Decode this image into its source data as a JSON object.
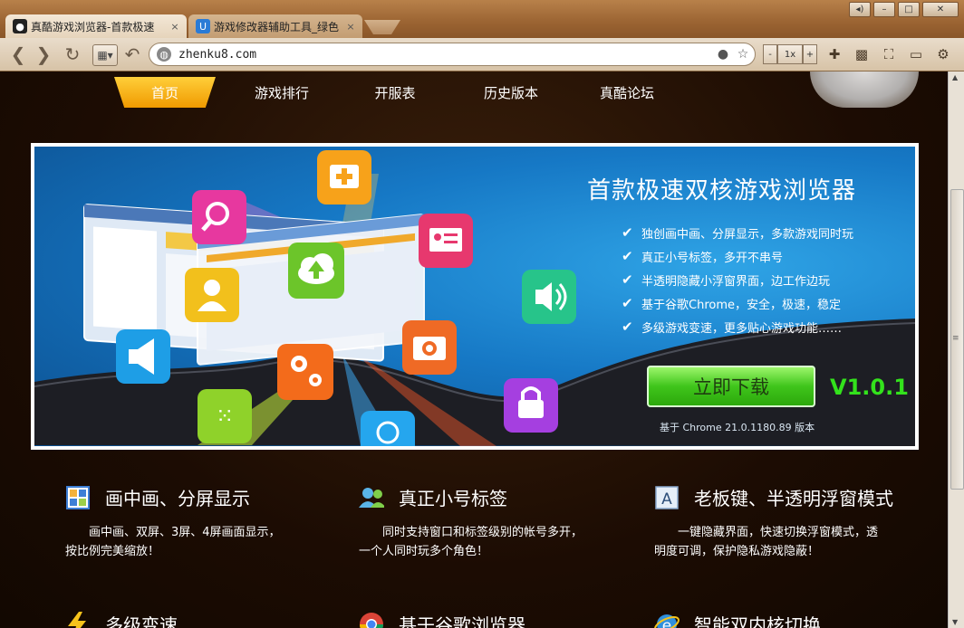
{
  "browser": {
    "tabs": [
      {
        "title": "真酷游戏浏览器-首款极速",
        "close": "×",
        "active": true
      },
      {
        "title": "游戏修改器辅助工具_绿色",
        "close": "×",
        "active": false
      }
    ],
    "window_controls": {
      "minimize": "–",
      "maximize": "□",
      "close": "✕"
    },
    "address": "zhenku8.com",
    "zoom": {
      "minus": "-",
      "level": "1x",
      "plus": "+"
    },
    "accent": "#9a6332"
  },
  "site": {
    "nav": [
      "首页",
      "游戏排行",
      "开服表",
      "历史版本",
      "真酷论坛"
    ],
    "banner": {
      "title": "首款极速双核游戏浏览器",
      "features": [
        "独创画中画、分屏显示，多款游戏同时玩",
        "真正小号标签，多开不串号",
        "半透明隐藏小浮窗界面，边工作边玩",
        "基于谷歌Chrome，安全，极速，稳定",
        "多级游戏变速，更多贴心游戏功能……"
      ],
      "download": "立即下载",
      "version": "V1.0.1",
      "based_on": "基于 Chrome 21.0.1180.89 版本",
      "download_color": "#3fc51b",
      "version_color": "#33e21c"
    },
    "features": [
      {
        "icon": "picture-in-picture-icon",
        "title": "画中画、分屏显示",
        "desc": "画中画、双屏、3屏、4屏画面显示，按比例完美缩放！"
      },
      {
        "icon": "users-icon",
        "title": "真正小号标签",
        "desc": "同时支持窗口和标签级别的帐号多开，一个人同时玩多个角色！"
      },
      {
        "icon": "letter-a-icon",
        "title": "老板键、半透明浮窗模式",
        "desc": "一键隐藏界面，快速切换浮窗模式，透明度可调，保护隐私游戏隐蔽！"
      }
    ],
    "features_partial": [
      {
        "icon": "lightning-icon",
        "title": "多级变速"
      },
      {
        "icon": "chrome-icon",
        "title": "基于谷歌浏览器"
      },
      {
        "icon": "ie-icon",
        "title": "智能双内核切换"
      }
    ]
  }
}
